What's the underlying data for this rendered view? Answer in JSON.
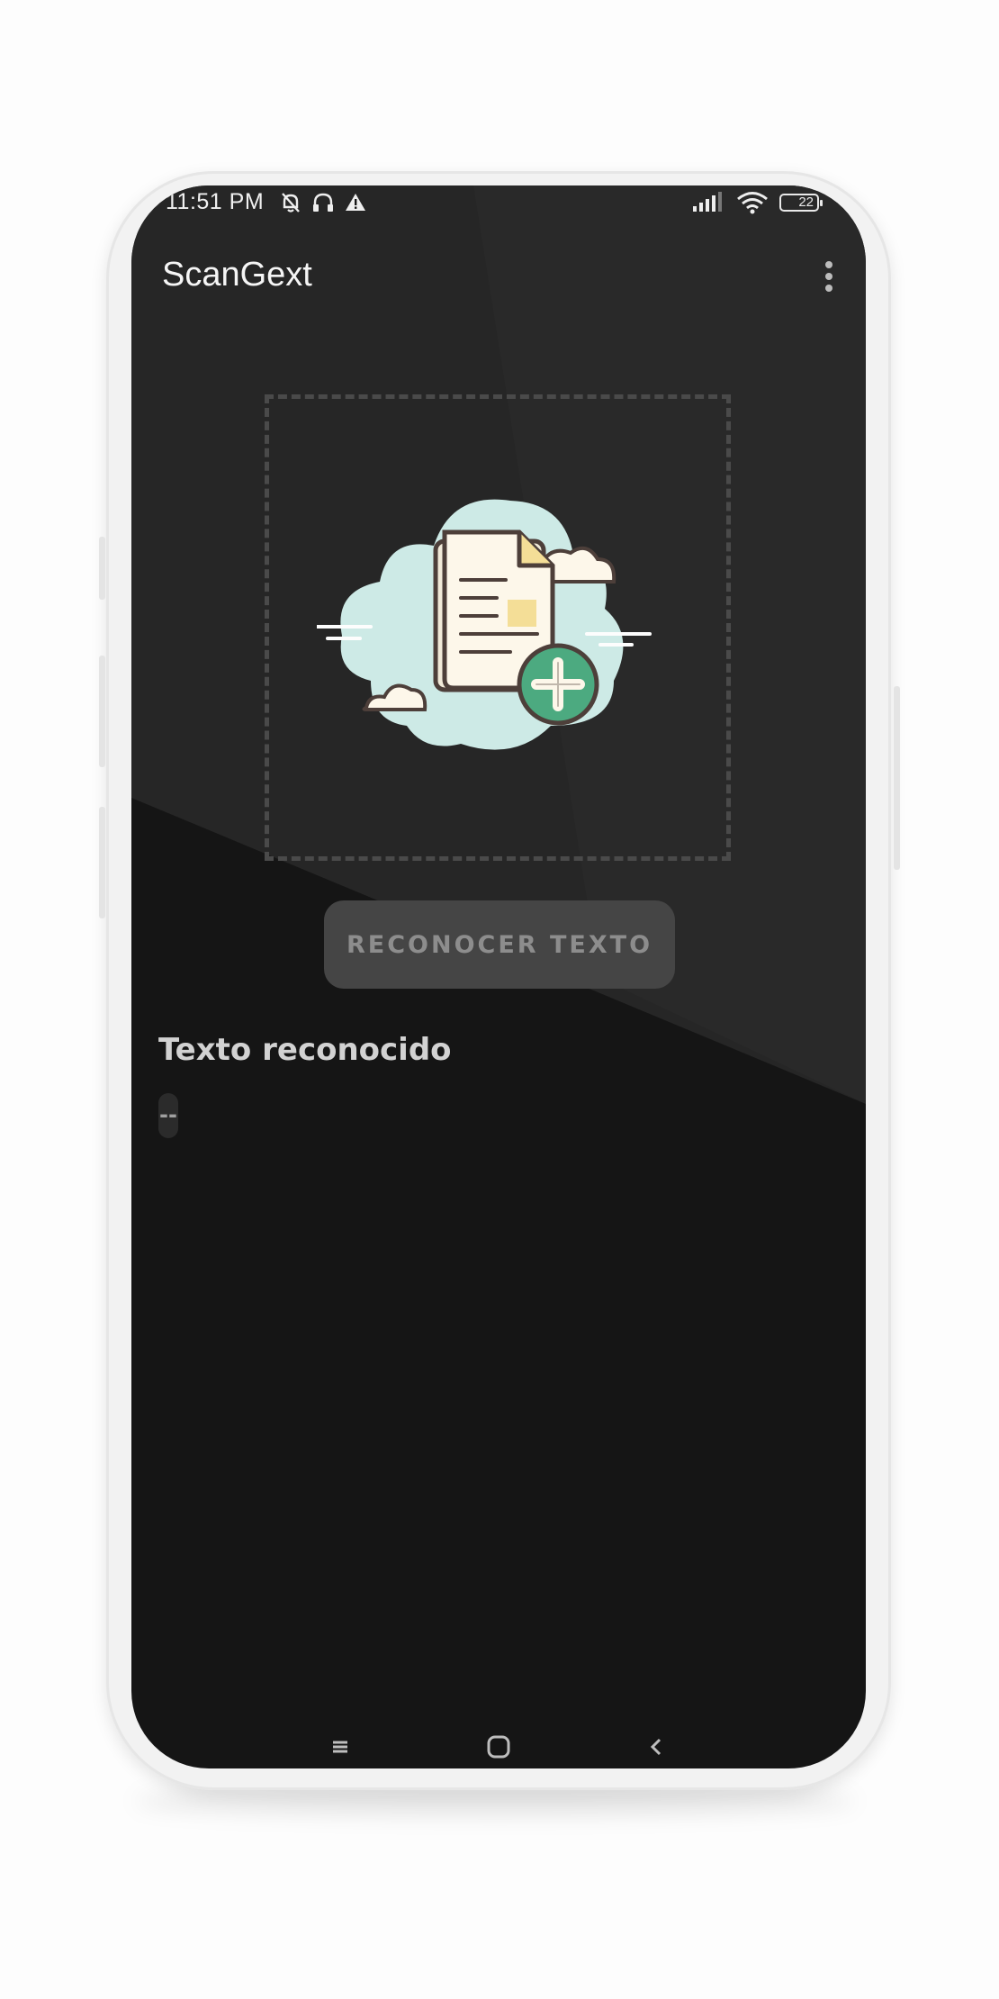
{
  "status_bar": {
    "time": "11:51 PM",
    "battery": "22",
    "icons_left": [
      "bell-off-icon",
      "headset-icon",
      "warning-icon"
    ],
    "icons_right": [
      "signal-icon",
      "wifi-icon",
      "battery-icon"
    ]
  },
  "app_bar": {
    "title": "ScanGext",
    "menu_icon": "more-vert-icon"
  },
  "image_area": {
    "icon": "add-document-cloud-icon"
  },
  "actions": {
    "recognize_label": "RECONOCER TEXTO"
  },
  "result": {
    "heading": "Texto reconocido",
    "value": "--"
  },
  "nav_bar": {
    "icons": [
      "recents-icon",
      "home-icon",
      "back-icon"
    ]
  },
  "colors": {
    "screen_bg": "#151515",
    "upper_bg": "#262626",
    "button_bg": "#454545",
    "cloud": "#cdeae6",
    "plus_badge": "#4caa80"
  }
}
